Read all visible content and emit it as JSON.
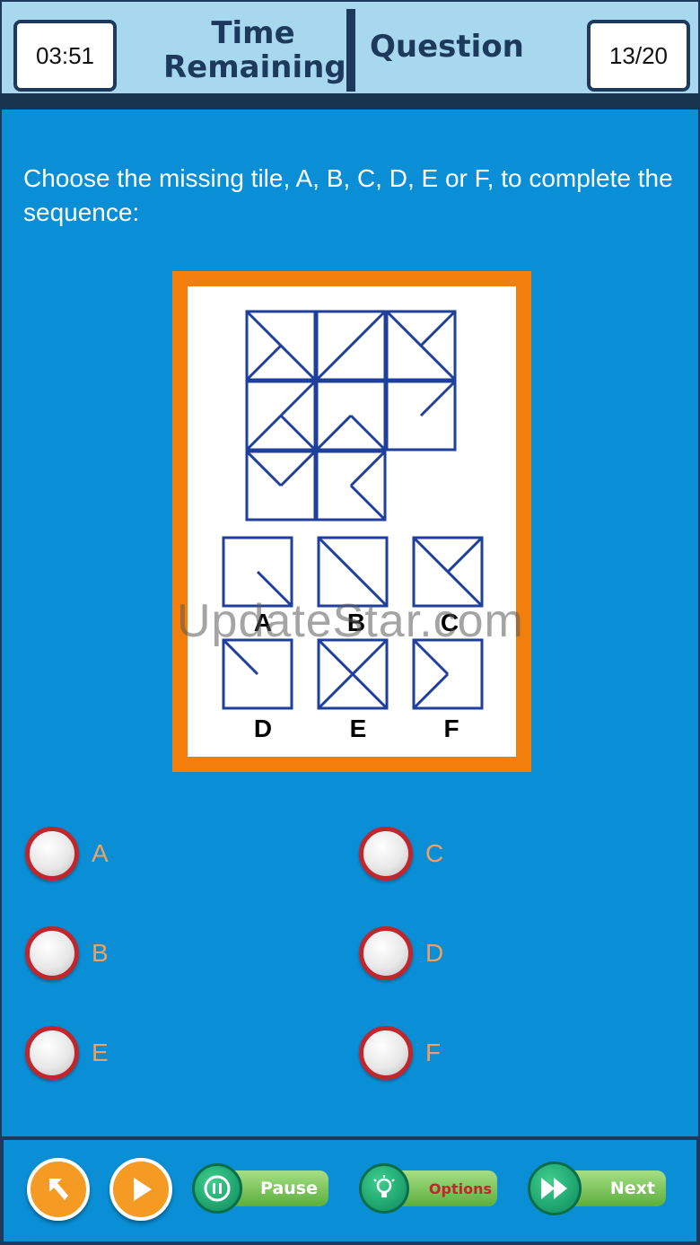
{
  "header": {
    "timer": "03:51",
    "time_label_line1": "Time",
    "time_label_line2": "Remaining",
    "question_label": "Question",
    "question_count": "13/20"
  },
  "prompt": "Choose the missing tile, A, B, C, D, E or F, to complete the sequence:",
  "puzzle": {
    "choice_labels": [
      "A",
      "B",
      "C",
      "D",
      "E",
      "F"
    ]
  },
  "watermark": "UpdateStar.com",
  "options": [
    {
      "label": "A"
    },
    {
      "label": "C"
    },
    {
      "label": "B"
    },
    {
      "label": "D"
    },
    {
      "label": "E"
    },
    {
      "label": "F"
    }
  ],
  "footer": {
    "pause_label": "Pause",
    "options_label": "Options",
    "next_label": "Next"
  },
  "colors": {
    "background": "#0a8fd6",
    "header": "#a8d8f0",
    "navy": "#1d3a5c",
    "frame": "#f27f0c",
    "radio_ring": "#c0262c",
    "option_text": "#f0a060",
    "pill_green": "#5cae3d",
    "options_text": "#c0262c"
  },
  "icons": [
    "back-arrow-icon",
    "play-icon",
    "pause-icon",
    "lightbulb-icon",
    "fast-forward-icon"
  ]
}
